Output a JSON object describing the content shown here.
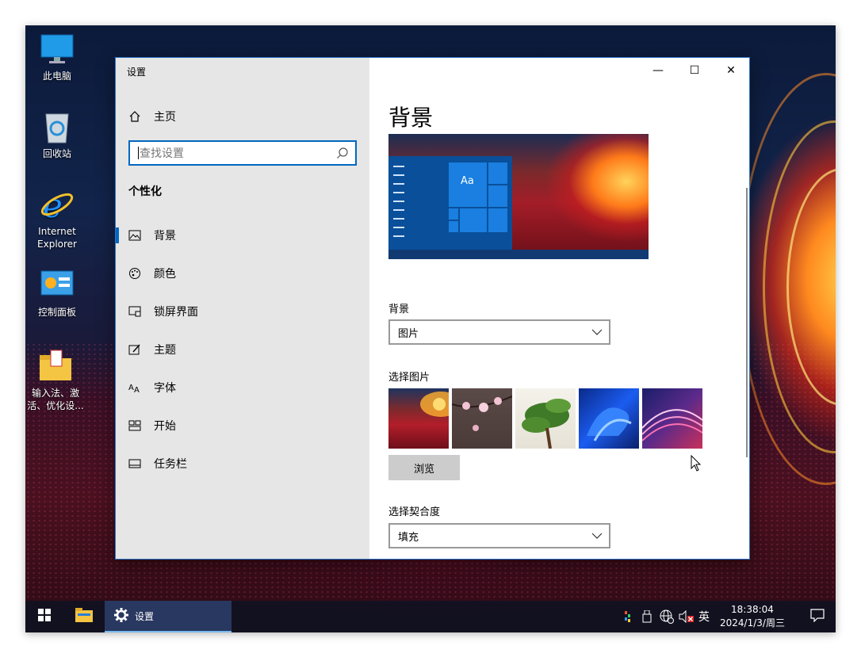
{
  "desktop": {
    "icons": [
      {
        "label": "此电脑"
      },
      {
        "label": "回收站"
      },
      {
        "label": "Internet Explorer"
      },
      {
        "label": "控制面板"
      },
      {
        "label": "输入法、激活、优化设..."
      }
    ]
  },
  "window": {
    "title": "设置",
    "controls": {
      "minimize": "—",
      "maximize": "☐",
      "close": "✕"
    },
    "nav": {
      "home_label": "主页",
      "search_placeholder": "查找设置",
      "section_title": "个性化",
      "items": [
        {
          "label": "背景",
          "icon": "picture-icon",
          "active": true
        },
        {
          "label": "颜色",
          "icon": "palette-icon",
          "active": false
        },
        {
          "label": "锁屏界面",
          "icon": "lock-screen-icon",
          "active": false
        },
        {
          "label": "主题",
          "icon": "theme-icon",
          "active": false
        },
        {
          "label": "字体",
          "icon": "font-icon",
          "active": false
        },
        {
          "label": "开始",
          "icon": "start-icon",
          "active": false
        },
        {
          "label": "任务栏",
          "icon": "taskbar-icon",
          "active": false
        }
      ]
    },
    "content": {
      "page_title": "背景",
      "preview_sample_text": "Aa",
      "background_label": "背景",
      "background_value": "图片",
      "choose_picture_label": "选择图片",
      "browse_label": "浏览",
      "fit_label": "选择契合度",
      "fit_value": "填充"
    }
  },
  "taskbar": {
    "active_app": "设置",
    "input_method": "英",
    "time": "18:38:04",
    "date": "2024/1/3/周三"
  },
  "colors": {
    "accent": "#0067c0",
    "nav_bg": "#e6e6e6"
  }
}
